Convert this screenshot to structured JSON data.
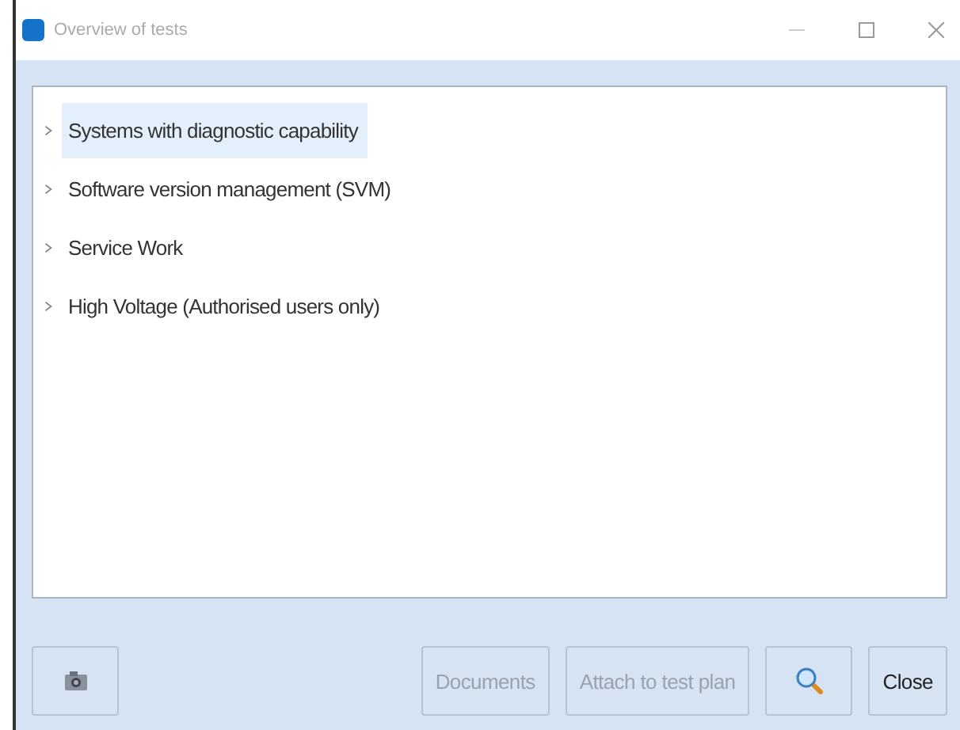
{
  "window": {
    "title": "Overview of tests"
  },
  "tree": {
    "items": [
      {
        "label": "Systems with diagnostic capability",
        "selected": true,
        "expanded": false
      },
      {
        "label": "Software version management (SVM)",
        "selected": false,
        "expanded": false
      },
      {
        "label": "Service Work",
        "selected": false,
        "expanded": false
      },
      {
        "label": "High Voltage (Authorised users only)",
        "selected": false,
        "expanded": false
      }
    ]
  },
  "buttons": [
    {
      "kind": "camera",
      "disabled": false
    },
    {
      "kind": "text",
      "label": "Documents",
      "disabled": true
    },
    {
      "kind": "text",
      "label": "Attach to test plan",
      "disabled": true
    },
    {
      "kind": "search",
      "disabled": false
    },
    {
      "kind": "text",
      "label": "Close",
      "disabled": false
    }
  ]
}
